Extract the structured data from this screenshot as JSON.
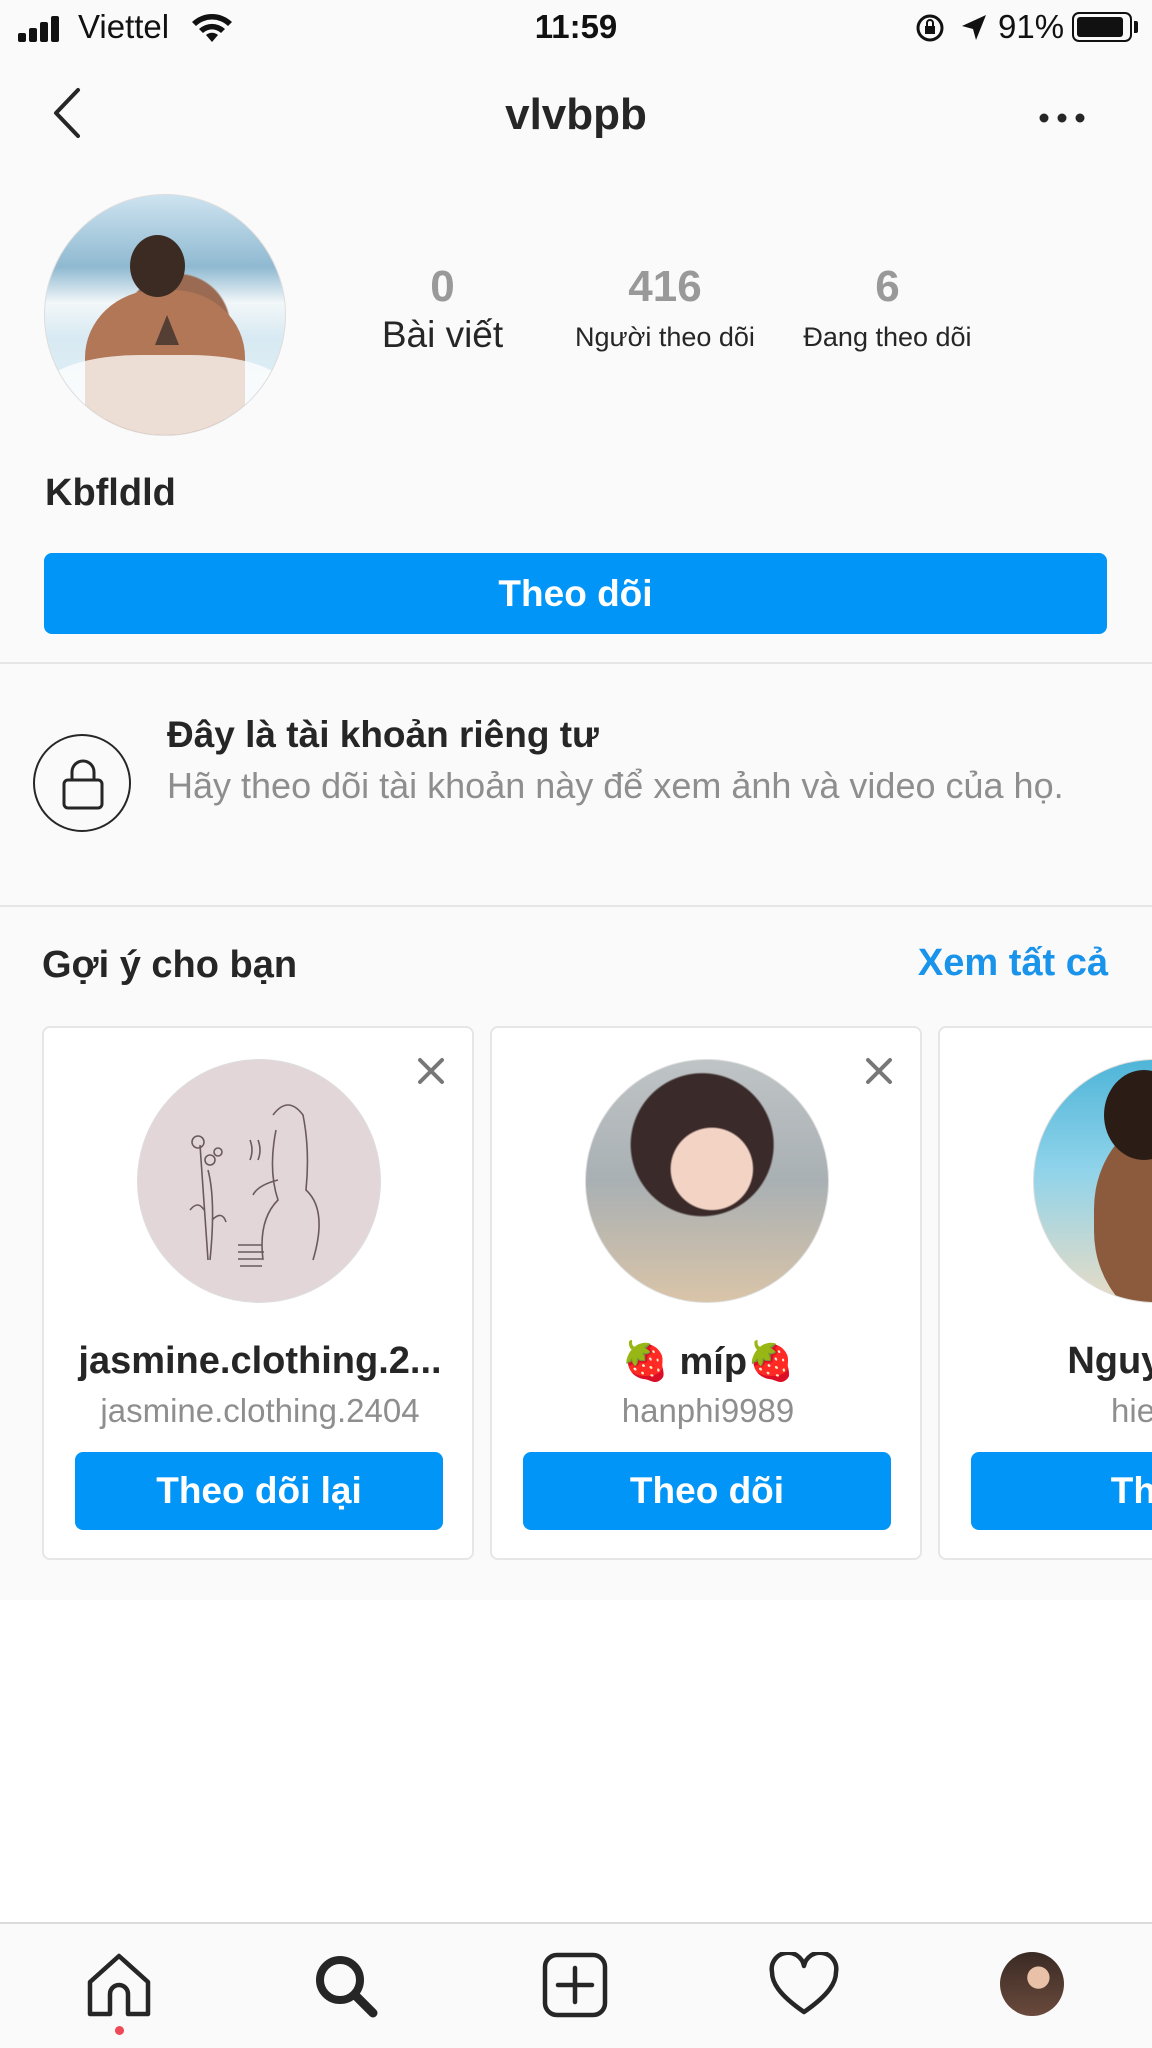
{
  "status_bar": {
    "carrier": "Viettel",
    "time": "11:59",
    "battery_percent": "91%",
    "battery_level": 0.91
  },
  "nav": {
    "title": "vlvbpb",
    "back_icon": "chevron-left-icon",
    "more_icon": "ellipsis-icon"
  },
  "profile": {
    "stats": [
      {
        "value": "0",
        "label": "Bài viết"
      },
      {
        "value": "416",
        "label": "Người theo dõi"
      },
      {
        "value": "6",
        "label": "Đang theo dõi"
      }
    ],
    "display_name": "Kbfldld",
    "follow_label": "Theo dõi"
  },
  "private": {
    "title": "Đây là tài khoản riêng tư",
    "description": "Hãy theo dõi tài khoản này để xem ảnh và video của họ."
  },
  "suggestions": {
    "title": "Gợi ý cho bạn",
    "see_all": "Xem tất cả",
    "cards": [
      {
        "name": "jasmine.clothing.2...",
        "handle": "jasmine.clothing.2404",
        "button": "Theo dõi lại"
      },
      {
        "name": "🍓 míp🍓",
        "handle": "hanphi9989",
        "button": "Theo dõi"
      },
      {
        "name": "Nguyễn H",
        "handle": "hieu.n",
        "button": "Theo"
      }
    ]
  },
  "tab_bar": {
    "items": [
      "home-icon",
      "search-icon",
      "new-post-icon",
      "activity-heart-icon",
      "profile-avatar"
    ]
  },
  "colors": {
    "accent": "#0095f6",
    "link": "#1a93ea",
    "background": "#fafafa",
    "notification_dot": "#ed4956"
  }
}
